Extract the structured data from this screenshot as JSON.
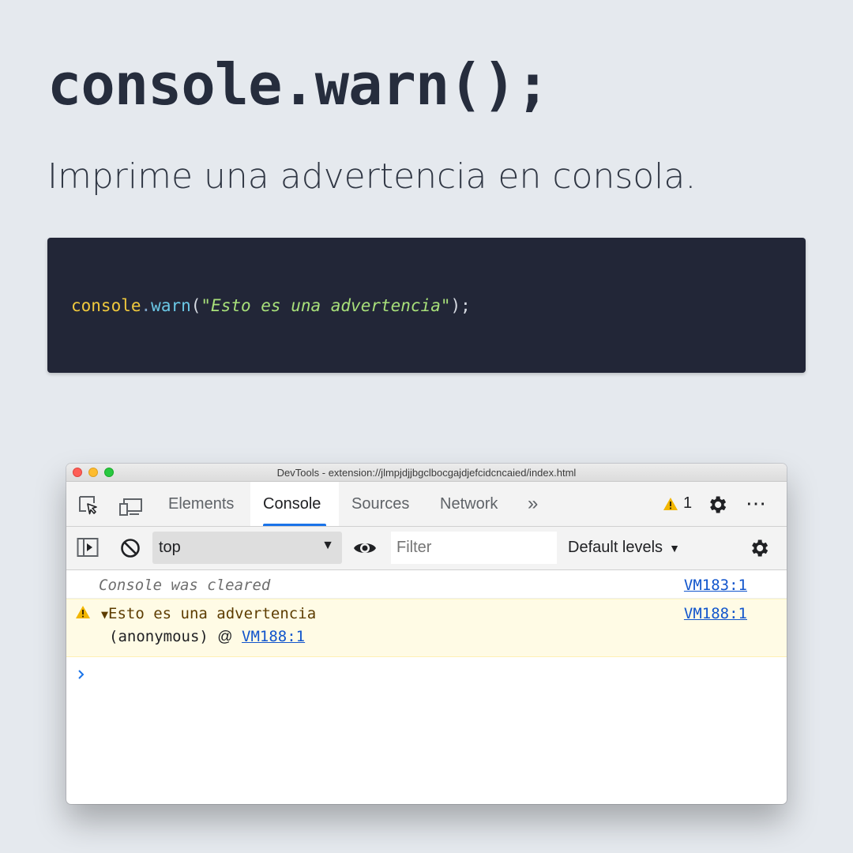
{
  "heading": "console.warn();",
  "subtitle": "Imprime una advertencia en consola.",
  "code": {
    "object": "console",
    "dot": ".",
    "method": "warn",
    "open": "(",
    "string": "\"Esto es una advertencia\"",
    "close": ");"
  },
  "devtools": {
    "window_title": "DevTools - extension://jlmpjdjjbgclbocgajdjefcidcncaied/index.html",
    "tabs": [
      {
        "label": "Elements",
        "active": false
      },
      {
        "label": "Console",
        "active": true
      },
      {
        "label": "Sources",
        "active": false
      },
      {
        "label": "Network",
        "active": false
      }
    ],
    "more_tabs": "»",
    "warning_count": "1",
    "menu_glyph": "⋯",
    "toolbar": {
      "context": "top",
      "filter_placeholder": "Filter",
      "levels": "Default levels"
    },
    "console": {
      "cleared_text": "Console was cleared",
      "cleared_source": "VM183:1",
      "warning_text": "Esto es una advertencia",
      "warning_source": "VM188:1",
      "trace_fn": "(anonymous)",
      "trace_at": "@",
      "trace_link": "VM188:1",
      "prompt": ">"
    },
    "colors": {
      "accent": "#1a73e8",
      "warning_bg": "#fffbe5",
      "warning_icon": "#f2b600",
      "link": "#1155cc"
    }
  }
}
